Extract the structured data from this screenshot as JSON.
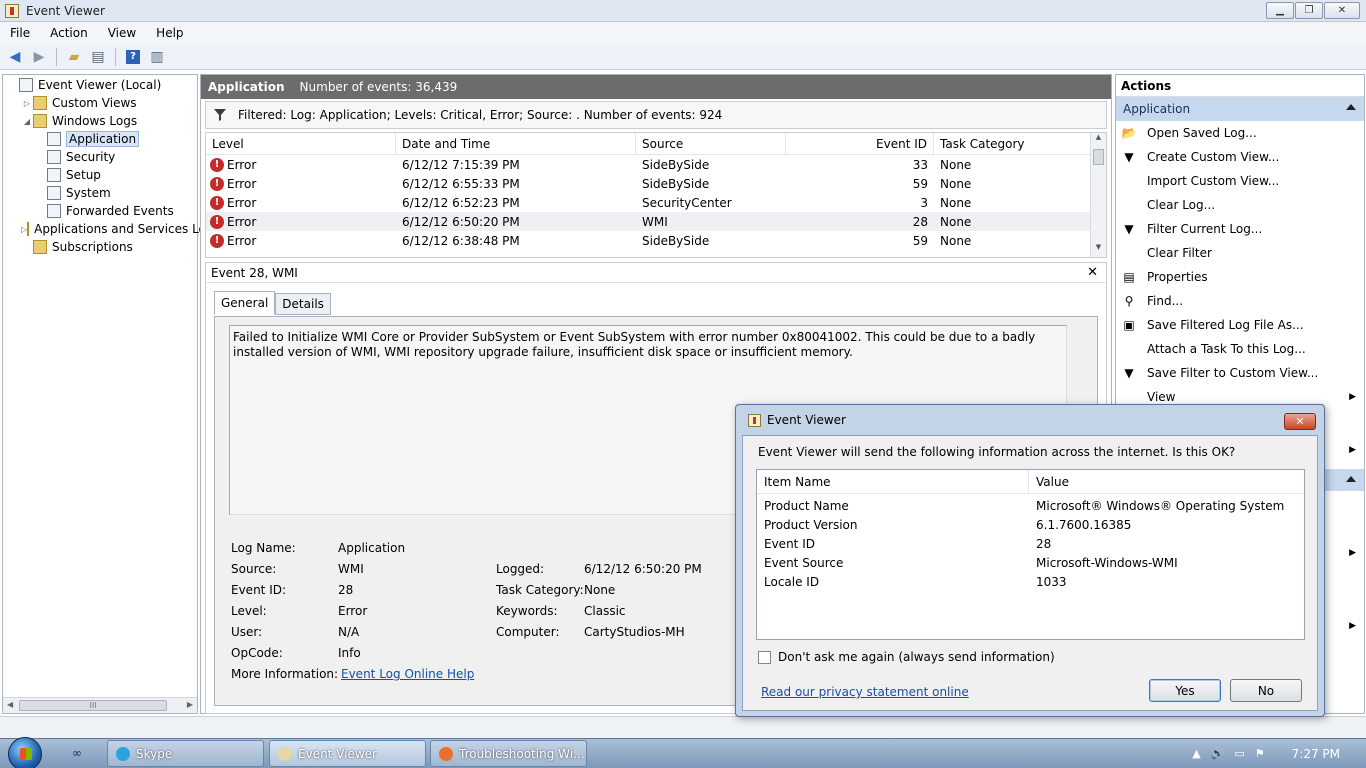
{
  "window": {
    "title": "Event Viewer"
  },
  "menu": [
    "File",
    "Action",
    "View",
    "Help"
  ],
  "tree": {
    "items": [
      {
        "label": "Event Viewer (Local)",
        "level": 0,
        "arrow": "",
        "icon": "log"
      },
      {
        "label": "Custom Views",
        "level": 1,
        "arrow": "▷",
        "icon": "folder"
      },
      {
        "label": "Windows Logs",
        "level": 1,
        "arrow": "◢",
        "icon": "folder"
      },
      {
        "label": "Application",
        "level": 2,
        "arrow": "",
        "icon": "log",
        "selected": true
      },
      {
        "label": "Security",
        "level": 2,
        "arrow": "",
        "icon": "log"
      },
      {
        "label": "Setup",
        "level": 2,
        "arrow": "",
        "icon": "log"
      },
      {
        "label": "System",
        "level": 2,
        "arrow": "",
        "icon": "log"
      },
      {
        "label": "Forwarded Events",
        "level": 2,
        "arrow": "",
        "icon": "log"
      },
      {
        "label": "Applications and Services Lo",
        "level": 1,
        "arrow": "▷",
        "icon": "folder"
      },
      {
        "label": "Subscriptions",
        "level": 1,
        "arrow": "",
        "icon": "folder"
      }
    ],
    "hscroll_thumb": "III"
  },
  "center": {
    "title": "Application",
    "count_text": "Number of events: 36,439",
    "filter_text": "Filtered: Log: Application; Levels: Critical, Error; Source: . Number of events: 924",
    "columns": [
      "Level",
      "Date and Time",
      "Source",
      "Event ID",
      "Task Category"
    ],
    "rows": [
      {
        "level": "Error",
        "date": "6/12/12 7:15:39 PM",
        "source": "SideBySide",
        "event_id": "33",
        "task": "None"
      },
      {
        "level": "Error",
        "date": "6/12/12 6:55:33 PM",
        "source": "SideBySide",
        "event_id": "59",
        "task": "None"
      },
      {
        "level": "Error",
        "date": "6/12/12 6:52:23 PM",
        "source": "SecurityCenter",
        "event_id": "3",
        "task": "None"
      },
      {
        "level": "Error",
        "date": "6/12/12 6:50:20 PM",
        "source": "WMI",
        "event_id": "28",
        "task": "None"
      },
      {
        "level": "Error",
        "date": "6/12/12 6:38:48 PM",
        "source": "SideBySide",
        "event_id": "59",
        "task": "None"
      }
    ]
  },
  "detail": {
    "title": "Event 28, WMI",
    "tabs": [
      "General",
      "Details"
    ],
    "message": "Failed to Initialize WMI Core or Provider SubSystem or Event SubSystem with error number 0x80041002. This could be due to a badly installed version of WMI, WMI repository upgrade failure, insufficient disk space or insufficient memory.",
    "props": {
      "log_name_label": "Log Name:",
      "log_name": "Application",
      "source_label": "Source:",
      "source": "WMI",
      "event_id_label": "Event ID:",
      "event_id": "28",
      "level_label": "Level:",
      "level": "Error",
      "user_label": "User:",
      "user": "N/A",
      "opcode_label": "OpCode:",
      "opcode": "Info",
      "more_info_label": "More Information:",
      "more_info_link": "Event Log Online Help",
      "logged_label": "Logged:",
      "logged": "6/12/12 6:50:20 PM",
      "task_cat_label": "Task Category:",
      "task_cat": "None",
      "keywords_label": "Keywords:",
      "keywords": "Classic",
      "computer_label": "Computer:",
      "computer": "CartyStudios-MH"
    }
  },
  "actions": {
    "title": "Actions",
    "section": "Application",
    "items": [
      {
        "label": "Open Saved Log...",
        "icon": "📂"
      },
      {
        "label": "Create Custom View...",
        "icon": "▼"
      },
      {
        "label": "Import Custom View...",
        "icon": ""
      },
      {
        "label": "Clear Log...",
        "icon": ""
      },
      {
        "label": "Filter Current Log...",
        "icon": "▼"
      },
      {
        "label": "Clear Filter",
        "icon": ""
      },
      {
        "label": "Properties",
        "icon": "▤"
      },
      {
        "label": "Find...",
        "icon": "⚲"
      },
      {
        "label": "Save Filtered Log File As...",
        "icon": "▣"
      },
      {
        "label": "Attach a Task To this Log...",
        "icon": ""
      },
      {
        "label": "Save Filter to Custom View...",
        "icon": "▼"
      },
      {
        "label": "View",
        "icon": "",
        "submenu": true
      }
    ]
  },
  "dialog": {
    "title": "Event Viewer",
    "close_glyph": "✕",
    "message": "Event Viewer will send the following information across the internet. Is this OK?",
    "columns": [
      "Item Name",
      "Value"
    ],
    "rows": [
      {
        "name": "Product Name",
        "value": "Microsoft® Windows® Operating System"
      },
      {
        "name": "Product Version",
        "value": "6.1.7600.16385"
      },
      {
        "name": "Event ID",
        "value": "28"
      },
      {
        "name": "Event Source",
        "value": "Microsoft-Windows-WMI"
      },
      {
        "name": "Locale ID",
        "value": "1033"
      }
    ],
    "checkbox_label": "Don't ask me again (always send information)",
    "privacy_link": "Read our privacy statement online",
    "yes_label": "Yes",
    "no_label": "No"
  },
  "taskbar": {
    "tasks": [
      {
        "label": "Skype",
        "color": "#2aa3e0"
      },
      {
        "label": "Event Viewer",
        "color": "#e7d7a0"
      },
      {
        "label": "Troubleshooting Wi...",
        "color": "#e8702a"
      }
    ],
    "clock": "7:27 PM"
  }
}
